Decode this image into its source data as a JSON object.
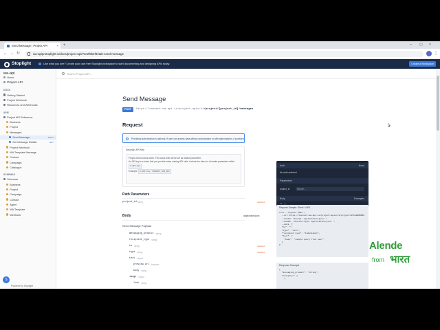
{
  "browser": {
    "tab_title": "Send Message | Project API",
    "tab_close": "×",
    "new_tab": "+",
    "url": "wa-apiprotoplight.io/docs/project-api/72c2f6b2f4/4ab-send-message",
    "win_min": "–",
    "win_max": "▢",
    "win_close": "×",
    "back": "←",
    "forward": "→",
    "reload": "↻"
  },
  "header": {
    "logo": "Stoplight",
    "banner": "Like what you see? Create your own free Stoplight workspace to start documenting and designing APIs today.",
    "workspace_button": "Create a Workspace"
  },
  "search": {
    "placeholder": "Search Project API..."
  },
  "sidebar": {
    "project": "wa-api",
    "items": [
      {
        "label": "Home",
        "kind": "link"
      },
      {
        "label": "Project API",
        "kind": "link-big"
      },
      {
        "label": "DOCS",
        "kind": "section"
      },
      {
        "label": "Getting Started",
        "kind": "item"
      },
      {
        "label": "Project Webhook",
        "kind": "item"
      },
      {
        "label": "Resources and Webhooks",
        "kind": "item"
      },
      {
        "label": "APIS",
        "kind": "section"
      },
      {
        "label": "Project API Reference",
        "kind": "item"
      },
      {
        "label": "Business",
        "kind": "sub"
      },
      {
        "label": "Project",
        "kind": "sub"
      },
      {
        "label": "Messages",
        "kind": "sub"
      },
      {
        "label": "Send Message",
        "kind": "sub2-active",
        "badge": "POST"
      },
      {
        "label": "Get Message Details",
        "kind": "sub2",
        "badge": "GET"
      },
      {
        "label": "Project Webhook",
        "kind": "sub"
      },
      {
        "label": "WA Template Message",
        "kind": "sub"
      },
      {
        "label": "Contact",
        "kind": "sub"
      },
      {
        "label": "Campaign",
        "kind": "sub"
      },
      {
        "label": "Catalogue",
        "kind": "sub"
      },
      {
        "label": "SCHEMAS",
        "kind": "section"
      },
      {
        "label": "Schemas",
        "kind": "item"
      },
      {
        "label": "Business",
        "kind": "sub"
      },
      {
        "label": "Project",
        "kind": "sub"
      },
      {
        "label": "Campaign",
        "kind": "sub"
      },
      {
        "label": "Contact",
        "kind": "sub"
      },
      {
        "label": "Agent",
        "kind": "sub"
      },
      {
        "label": "WA Template",
        "kind": "sub"
      },
      {
        "label": "Webhook",
        "kind": "sub"
      }
    ],
    "footer": "Powered by Stoplight",
    "fab_icon": "S"
  },
  "main": {
    "title": "Send Message",
    "method": "POST",
    "endpoint_base": "https://connect.wa-api.io/project-apis/v1",
    "endpoint_path": "/project/{project_id}/messages",
    "request_title": "Request",
    "auth_note": "Providing authorization is optional. If user can access data without authorization or with authorization, if provided.",
    "security_head": "Security: API Key",
    "security_line1": "Project-level access token. Find value with will be set as default parameter.",
    "security_line2": "An API key is a token that you provide when making API calls. Include the token in a header parameter called",
    "security_code1": "X-API-Key",
    "security_example": "Example:",
    "security_code2": "X-API-Key: PROJECT_API_KEY",
    "path_params_title": "Path Parameters",
    "path_param_name": "project_id",
    "path_param_type": "string",
    "required": "required",
    "body_title": "Body",
    "body_content_type": "application/json",
    "payload_label": "Send Message Payload",
    "fields": [
      {
        "name": "messaging_product",
        "type": "string",
        "req": false
      },
      {
        "name": "recipient_type",
        "type": "string",
        "req": false
      },
      {
        "name": "to",
        "type": "string",
        "req": true
      },
      {
        "name": "type",
        "type": "string",
        "req": true
      },
      {
        "name": "text",
        "type": "object",
        "req": false
      },
      {
        "name": "preview_url",
        "type": "boolean",
        "req": false
      },
      {
        "name": "body",
        "type": "string",
        "req": false
      },
      {
        "name": "image",
        "type": "object",
        "req": false
      },
      {
        "name": "link",
        "type": "string",
        "req": false
      }
    ]
  },
  "try_panel": {
    "auth_head": "Auth",
    "auth_none": "None",
    "auth_value": "No auth selected",
    "params_head": "Parameters",
    "param_name": "project_id",
    "param_value": "85uofe…",
    "body_head": "Body",
    "examples": "Examples",
    "code": "1  {\n2    \"to\": \"\",\n3    \"type\": \"text\",\n4    \"recipient_type\": \"individual\",\n5    \"text\": {\n6      \"body\": \"sample query from user\"\n7    }\n8  }",
    "send_button": "Send API Request"
  },
  "request_sample": {
    "head": "Request Sample: Shell / cURL",
    "code": "curl --request POST \\\n  --url https://connect.wa-api.io/project-apis/v1/project/851180RRKR4\n  --header 'Accept: application/json' \\\n  --header 'Content-Type: application/json' \\\n  --data '{\n  \"to\": \"\",\n  \"type\": \"text\",\n  \"recipient_type\": \"individual\",\n  \"text\": {\n    \"body\": \"sample query from user\"\n  }\n}'"
  },
  "response_sample": {
    "head": "Response Example",
    "code": "{\n  \"messaging_product\": \"string\",\n  \"contacts\": [\n    {"
  },
  "watermark": {
    "word1": "Alende",
    "word2": "from",
    "word3": "भारत",
    "color": "#2f9e3a"
  },
  "colors": {
    "accent": "#3b7ad9",
    "header": "#1b2b47",
    "panel": "#1d2737"
  }
}
